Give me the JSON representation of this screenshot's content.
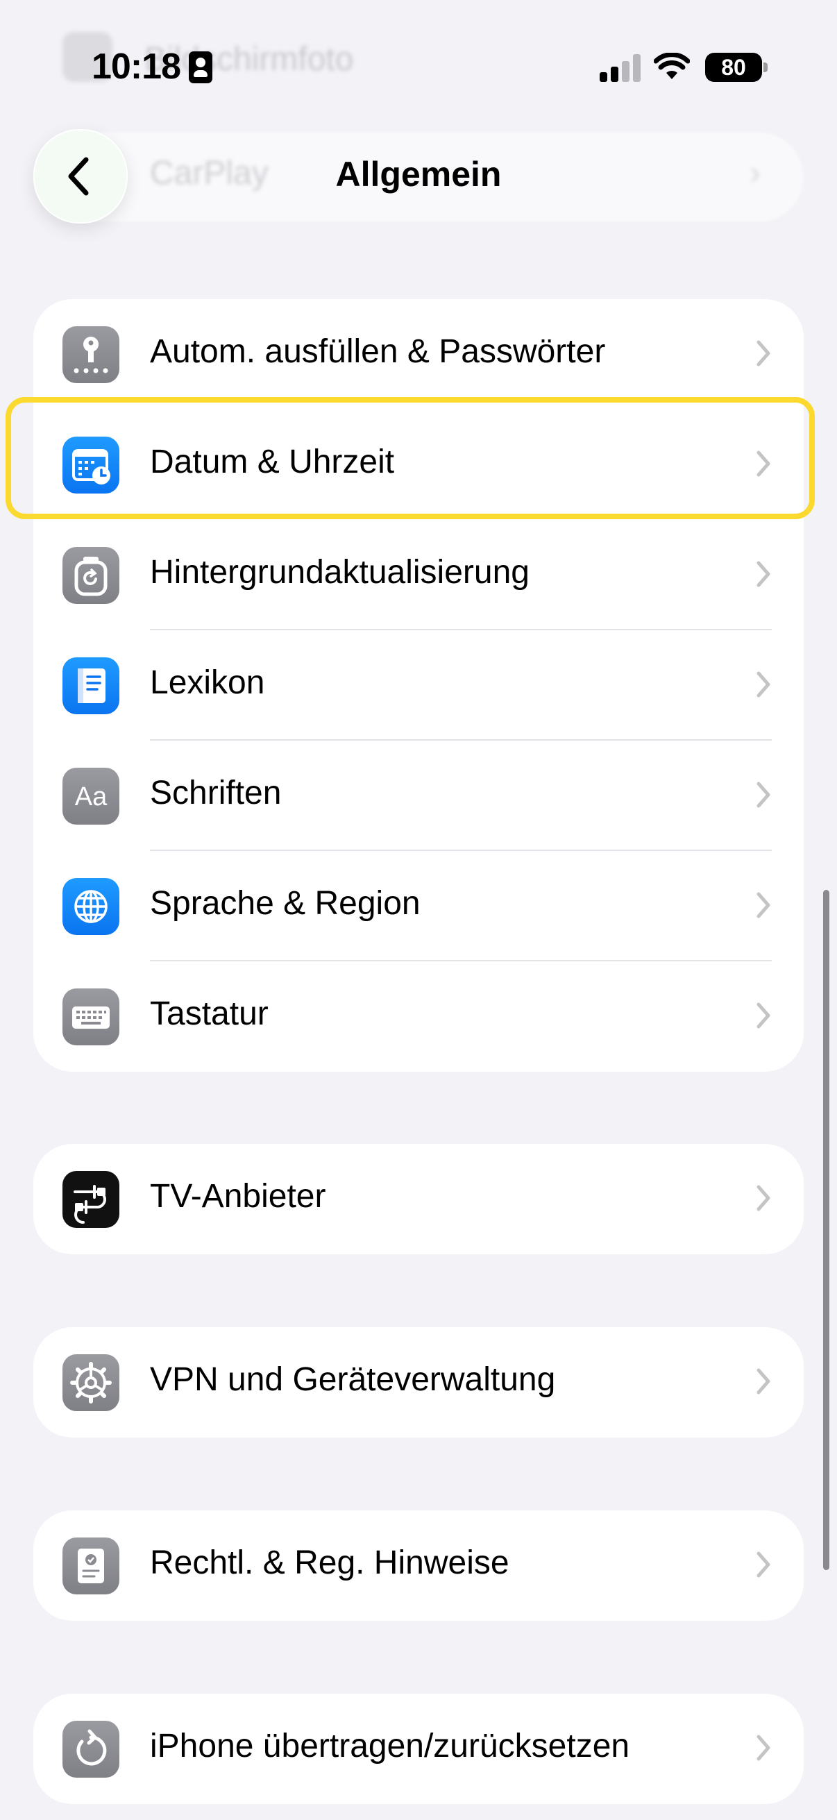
{
  "status_bar": {
    "time": "10:18",
    "battery": "80",
    "ghost_label": "Bildschirmfoto"
  },
  "nav": {
    "title": "Allgemein",
    "ghost_label": "CarPlay"
  },
  "groups": [
    {
      "items": [
        {
          "label": "Autom. ausfüllen & Passwörter",
          "icon": "key-icon"
        },
        {
          "label": "Datum & Uhrzeit",
          "icon": "calendar-clock-icon"
        },
        {
          "label": "Hintergrundaktualisierung",
          "icon": "background-refresh-icon"
        },
        {
          "label": "Lexikon",
          "icon": "book-icon"
        },
        {
          "label": "Schriften",
          "icon": "fonts-icon"
        },
        {
          "label": "Sprache & Region",
          "icon": "globe-icon"
        },
        {
          "label": "Tastatur",
          "icon": "keyboard-icon"
        }
      ]
    },
    {
      "items": [
        {
          "label": "TV-Anbieter",
          "icon": "tv-provider-icon"
        }
      ]
    },
    {
      "items": [
        {
          "label": "VPN und Geräteverwaltung",
          "icon": "gear-icon"
        }
      ]
    },
    {
      "items": [
        {
          "label": "Rechtl. & Reg. Hinweise",
          "icon": "certificate-icon"
        }
      ]
    },
    {
      "items": [
        {
          "label": "iPhone übertragen/zurücksetzen",
          "icon": "reset-icon"
        }
      ]
    }
  ],
  "highlighted_item": "Datum & Uhrzeit",
  "colors": {
    "highlight": "#fcd92e",
    "icon_blue": "#0a74f0",
    "icon_gray": "#8a8a90",
    "background": "#f2f2f7"
  }
}
